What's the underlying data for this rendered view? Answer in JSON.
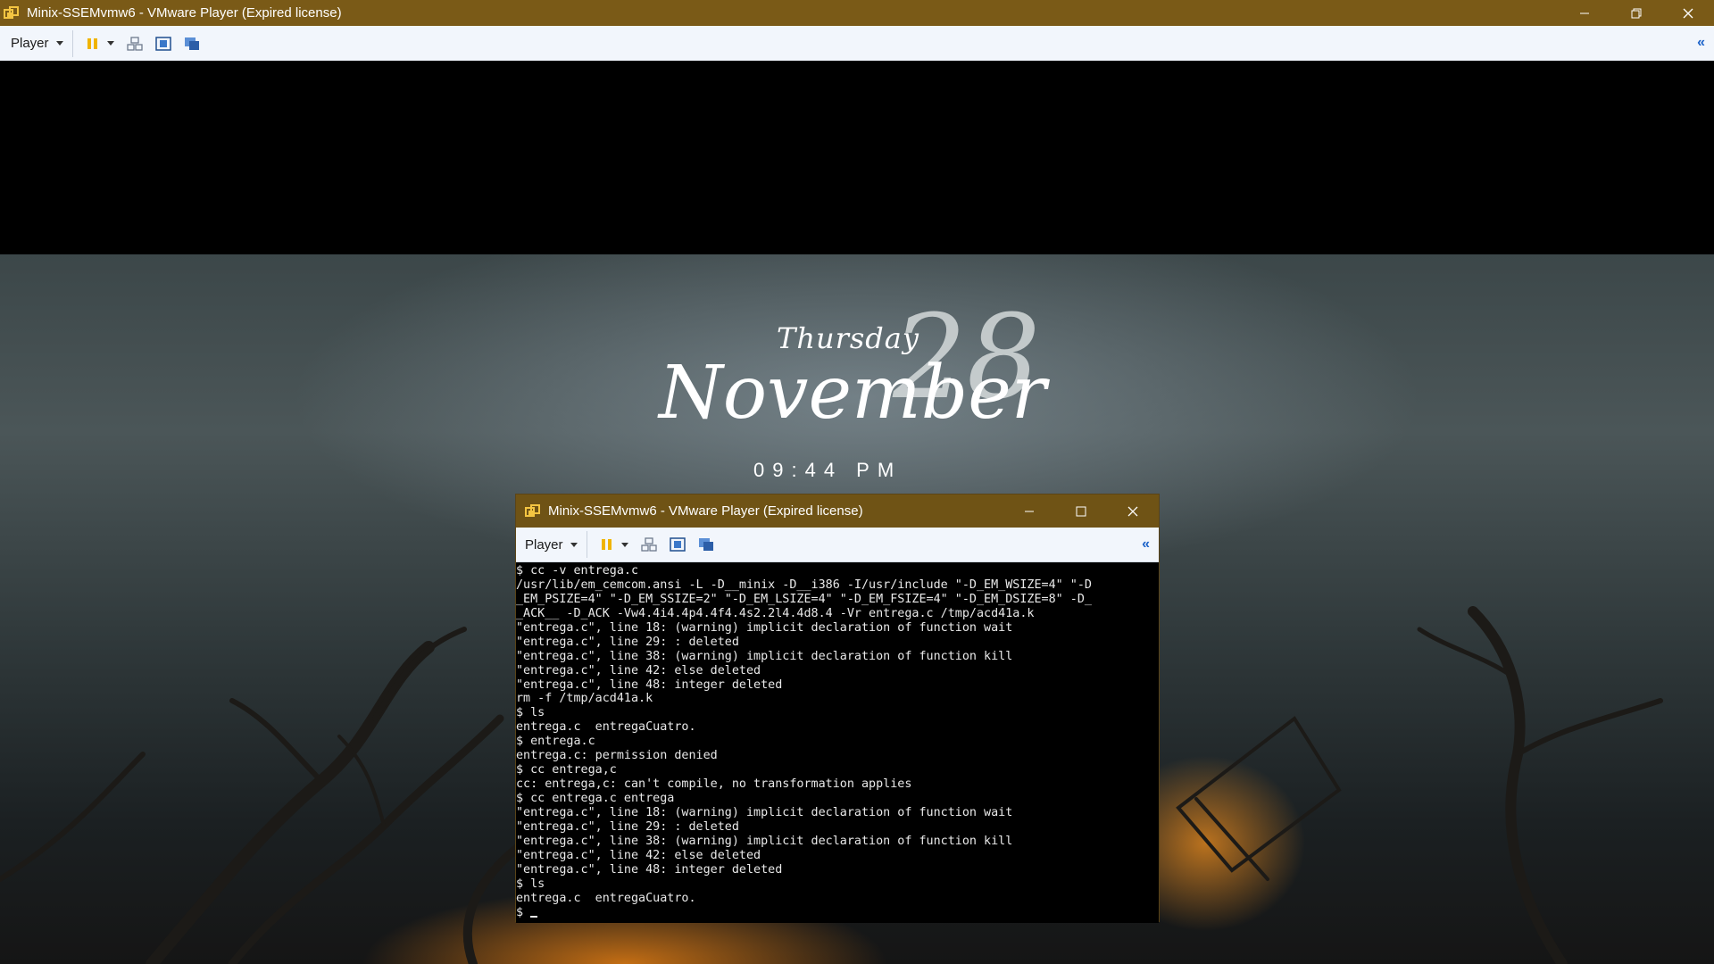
{
  "window": {
    "title": "Minix-SSEMvmw6 - VMware Player (Expired license)"
  },
  "toolbar": {
    "player_label": "Player",
    "collapse_glyph": "«"
  },
  "lockscreen": {
    "day": "Thursday",
    "date_number": "28",
    "month": "November",
    "time": "09:44 PM"
  },
  "inner_window": {
    "title": "Minix-SSEMvmw6 - VMware Player (Expired license)",
    "player_label": "Player",
    "collapse_glyph": "«"
  },
  "terminal": {
    "lines": [
      "$ cc -v entrega.c",
      "/usr/lib/em_cemcom.ansi -L -D__minix -D__i386 -I/usr/include \"-D_EM_WSIZE=4\" \"-D",
      "_EM_PSIZE=4\" \"-D_EM_SSIZE=2\" \"-D_EM_LSIZE=4\" \"-D_EM_FSIZE=4\" \"-D_EM_DSIZE=8\" -D_",
      "_ACK__ -D_ACK -Vw4.4i4.4p4.4f4.4s2.2l4.4d8.4 -Vr entrega.c /tmp/acd41a.k",
      "\"entrega.c\", line 18: (warning) implicit declaration of function wait",
      "\"entrega.c\", line 29: : deleted",
      "\"entrega.c\", line 38: (warning) implicit declaration of function kill",
      "\"entrega.c\", line 42: else deleted",
      "\"entrega.c\", line 48: integer deleted",
      "rm -f /tmp/acd41a.k",
      "$ ls",
      "entrega.c  entregaCuatro.",
      "$ entrega.c",
      "entrega.c: permission denied",
      "$ cc entrega,c",
      "cc: entrega,c: can't compile, no transformation applies",
      "$ cc entrega.c entrega",
      "\"entrega.c\", line 18: (warning) implicit declaration of function wait",
      "\"entrega.c\", line 29: : deleted",
      "\"entrega.c\", line 38: (warning) implicit declaration of function kill",
      "\"entrega.c\", line 42: else deleted",
      "\"entrega.c\", line 48: integer deleted",
      "$ ls",
      "entrega.c  entregaCuatro.",
      "$ "
    ]
  }
}
